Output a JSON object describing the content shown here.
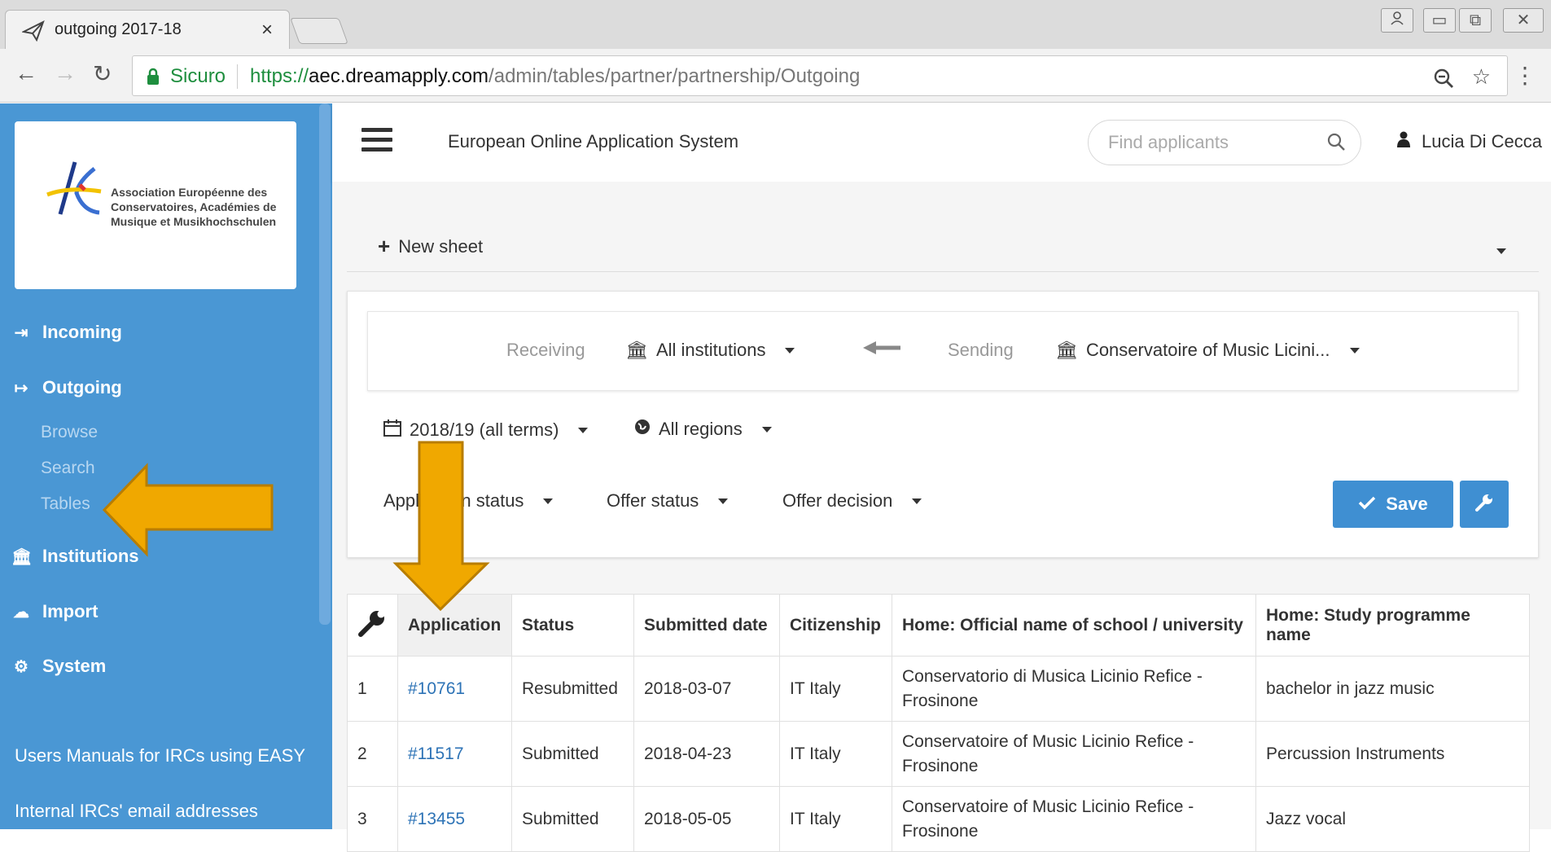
{
  "browser": {
    "tab_title": "outgoing 2017-18",
    "tab_close": "×",
    "secure_label": "Sicuro",
    "url_proto": "https://",
    "url_host": "aec.dreamapply.com",
    "url_path": "/admin/tables/partner/partnership/Outgoing"
  },
  "sidebar": {
    "logo_text": "Association Européenne des Conservatoires, Académies de Musique et Musikhochschulen",
    "items": [
      {
        "label": "Incoming",
        "icon": "sign-in-icon"
      },
      {
        "label": "Outgoing",
        "icon": "sign-out-icon"
      },
      {
        "label": "Institutions",
        "icon": "bank-icon"
      },
      {
        "label": "Import",
        "icon": "cloud-upload-icon"
      },
      {
        "label": "System",
        "icon": "gear-icon"
      }
    ],
    "outgoing_sub": [
      "Browse",
      "Search",
      "Tables"
    ],
    "links": [
      "Users Manuals for IRCs using EASY",
      "Internal IRCs' email addresses"
    ]
  },
  "header": {
    "app_title": "European Online Application System",
    "search_placeholder": "Find applicants",
    "user_name": "Lucia Di Cecca"
  },
  "sheet": {
    "new_sheet_label": "New sheet"
  },
  "filters": {
    "receiving_label": "Receiving",
    "receiving_value": "All institutions",
    "sending_label": "Sending",
    "sending_value": "Conservatoire of Music Licini...",
    "term": "2018/19 (all terms)",
    "region": "All regions",
    "application_status": "Application status",
    "offer_status": "Offer status",
    "offer_decision": "Offer decision",
    "save_label": "Save"
  },
  "table": {
    "headers": [
      "Application",
      "Status",
      "Submitted date",
      "Citizenship",
      "Home: Official name of school / university",
      "Home: Study programme name"
    ],
    "rows": [
      {
        "n": "1",
        "app": "#10761",
        "status": "Resubmitted",
        "date": "2018-03-07",
        "cit": "IT Italy",
        "school": "Conservatorio di Musica Licinio Refice - Frosinone",
        "prog": "bachelor in jazz music"
      },
      {
        "n": "2",
        "app": "#11517",
        "status": "Submitted",
        "date": "2018-04-23",
        "cit": "IT Italy",
        "school": "Conservatoire of Music Licinio Refice - Frosinone",
        "prog": "Percussion Instruments"
      },
      {
        "n": "3",
        "app": "#13455",
        "status": "Submitted",
        "date": "2018-05-05",
        "cit": "IT Italy",
        "school": "Conservatoire of Music Licinio Refice - Frosinone",
        "prog": "Jazz vocal"
      }
    ]
  },
  "colors": {
    "sidebar": "#4a97d4",
    "primary": "#3f8fd2",
    "link": "#2d73b6",
    "annotation_arrow": "#f0a800"
  }
}
